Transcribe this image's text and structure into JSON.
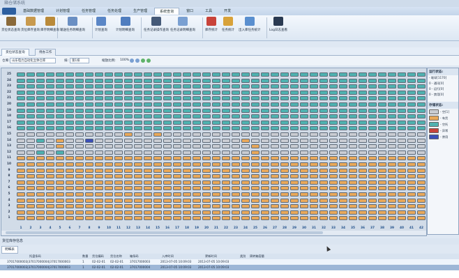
{
  "window": {
    "title": "箱仓储系统"
  },
  "menu": [
    {
      "label": "基础数据管理",
      "active": false
    },
    {
      "label": "计划管理",
      "active": false
    },
    {
      "label": "任务管理",
      "active": false
    },
    {
      "label": "任务处理",
      "active": false
    },
    {
      "label": "生产管理",
      "active": false
    },
    {
      "label": "系统查询",
      "active": true
    },
    {
      "label": "窗口",
      "active": false
    },
    {
      "label": "工具",
      "active": false
    },
    {
      "label": "开发",
      "active": false
    }
  ],
  "ribbon": [
    {
      "label": "货位状态查询",
      "icon": "shelf-icon",
      "color": "#8a6a3b"
    },
    {
      "label": "货位库存查询",
      "icon": "box-icon",
      "color": "#c89a4e"
    },
    {
      "label": "库存明细查询",
      "icon": "boxes-icon",
      "color": "#b98a3a"
    },
    {
      "label": "输送任务明细查询",
      "icon": "conveyor-icon",
      "color": "#6a8fc3"
    },
    {
      "label": "计划查询",
      "icon": "plan-icon",
      "color": "#5a86c6"
    },
    {
      "label": "计划明细查询",
      "icon": "plan-detail-icon",
      "color": "#4f7dbf"
    },
    {
      "label": "任务记录操作查询",
      "icon": "record-icon",
      "color": "#455a78"
    },
    {
      "label": "任务记录明细查询",
      "icon": "record-detail-icon",
      "color": "#7aa0d2"
    },
    {
      "label": "库存统计",
      "icon": "stats-icon",
      "color": "#c8433a"
    },
    {
      "label": "任务统计",
      "icon": "task-stats-icon",
      "color": "#d8a23a"
    },
    {
      "label": "出入库任务统计",
      "icon": "inout-icon",
      "color": "#5a8fcf"
    },
    {
      "label": "Log日志查看",
      "icon": "log-icon",
      "color": "#2a3a52"
    }
  ],
  "tabs": [
    {
      "label": "货位状态查询",
      "active": true
    },
    {
      "label": "待办工作",
      "active": false
    }
  ],
  "toolbar": {
    "warehouse_label": "仓库:",
    "warehouse_value": "山东电力自动化立体仓库",
    "row_label": "排:",
    "row_value": "第1排",
    "scale_label": "缩放比例:",
    "scale_value": "100%"
  },
  "grid": {
    "rows": 25,
    "cols": 42,
    "row_labels": [
      "25",
      "24",
      "23",
      "22",
      "21",
      "20",
      "19",
      "18",
      "17",
      "16",
      "15",
      "14",
      "13",
      "12",
      "11",
      "10",
      "9",
      "8",
      "7",
      "6",
      "5",
      "4",
      "3",
      "2",
      "1"
    ],
    "col_labels": [
      "1",
      "2",
      "3",
      "4",
      "5",
      "6",
      "7",
      "8",
      "9",
      "10",
      "11",
      "12",
      "13",
      "14",
      "15",
      "16",
      "17",
      "18",
      "19",
      "20",
      "21",
      "22",
      "23",
      "24",
      "25",
      "26",
      "27",
      "28",
      "29",
      "30",
      "31",
      "32",
      "33",
      "34",
      "35",
      "36",
      "37",
      "38",
      "39",
      "40",
      "41",
      "42"
    ],
    "cells": [
      "TTTTTTTTTTTTTTTTTTTTTTTTTTTTTTTTTTTTTTTTTT",
      "TTTTTTTTTTTTTTTTTTTTTTTTTTTTTTTTTTTTTTTTTT",
      "TTTTTTTTTTTTTTTTTTTTTTTTTTTTTTTTTTTTTTTTTT",
      "TTTTTTTTTTTTTTTTTTTTTTTTTTTTTTTTTTTTTTTTTT",
      "TTTTTTTTTTTTTTTTTTTTTTTTTTTTTTTTTTTTTTTTTT",
      "TTTTTTTTTTTTTTTTTTTTTTTTTTTTTTTTTTTTTTTTTT",
      "TTTTTTTTTTTTTTTTTTTTTTTTTTTTTTTTTTTTTTTTTT",
      "TTTTTTTTTTTTTTTTTTTTTTTTTTTTTTTTTTTTTTTTTT",
      "TTTTTTTTTTTTTTTTTTTTTTTTTTTTTTTTTTTTTTTTTT",
      "TTTTTTTTTTTTTTTTTTTTTTTTTTTTTTTTTTTTTTTTTT",
      "GGGGGGGGGGGOGGOGGGGGGGGGGGGGGGGGGGGGGGGGGG",
      "GGTGOGGBGGGGGGGGGGGGGGGOGGGGGGGGGGGGGGGGGG",
      "GGGGOGGGGGGGGGGGGGGGGGGGOGGGGGGGGGGGGGGGGG",
      "GGTGTGGGGGGGGGGGGGGGGGGGOGGGGGGGGGGGGGGGGG",
      "OOOOOOOOOOOOOOOOOOOOOOOOOOOOOOOOOOOOOOOOOO",
      "OOOOOOOOOOOOOOOOOOOOOOOOOOOOOOOOOOOOOOOOOO",
      "OOOOOOOOOOOOOOOOOOOOOOOOOOOOOOOOOOOOOOOOOO",
      "OOOOOOOOOOOOOOOOOOOOOOOOOOOOOOOOOOOOOOOOOO",
      "OOOOOOOOOOOOOOOOOOOOOOOOOOOOOOOOOOOOOOOOOO",
      "OOOOOOOOOOOOOOOOOOOOOOOOOOOOOOOOOOOOOOOOOO",
      "OOOOOOOOOOOOOOOOOOOOOOOOOOOOOOOOOOOOOOOOOO",
      "OOOOOOOOOOOOOOOOOOOOOOOOOOOOOOOOOOOOOOOOOO",
      "OOOOOOOOOOOOOOOOOOOOOOOOOOOOOOOOOOOOOOOOOO",
      "OOOOOOOOOOOOOOOOOOOOOOOOOOOOOOOOOOOOOOOOOO",
      "OOOOOOOOOOOOOOOOOOOOOOOOOOOOOOOOOOOOOOOOOO"
    ],
    "colors": {
      "T": "#4fb2b0",
      "G": "#c9ccd2",
      "O": "#e8a85a",
      "B": "#3b4fb8",
      "R": "#c8433a"
    }
  },
  "side": {
    "status_title": "运行状态:",
    "status_items": [
      "- 堆垛[1170]",
      "0 - 通讯[0]",
      "0 - 运行[0]",
      "0 - 禁用[0]"
    ],
    "legend_title": "存储状态:",
    "legend": [
      {
        "label": "- 空[1]",
        "color": "#c9ccd2"
      },
      {
        "label": "- 有货",
        "color": "#e8a85a"
      },
      {
        "label": "- 空托",
        "color": "#4fb2b0"
      },
      {
        "label": "- 异常",
        "color": "#c8433a"
      },
      {
        "label": "- 禁用",
        "color": "#3b4fb8"
      }
    ]
  },
  "bottom": {
    "panel_title": "货位库存信息",
    "tab_label": "明细表",
    "columns": [
      "托盘条码",
      "数量",
      "货位编码",
      "货位名称",
      "箱条码",
      "入库时间",
      "更新时间",
      "类别",
      "周转箱容量"
    ],
    "rows": [
      [
        "37017000003|37017000004|37017000003",
        "1",
        "02-02-01",
        "02-02-01",
        "37017000003",
        "2013-07-05 10:09:03",
        "2013-07-05 10:09:03",
        "",
        ""
      ],
      [
        "37017000003|37017000004|37017000003",
        "1",
        "02-02-01",
        "02-02-01",
        "37017000004",
        "2013-07-05 10:09:03",
        "2013-07-05 10:09:03",
        "",
        ""
      ]
    ]
  }
}
